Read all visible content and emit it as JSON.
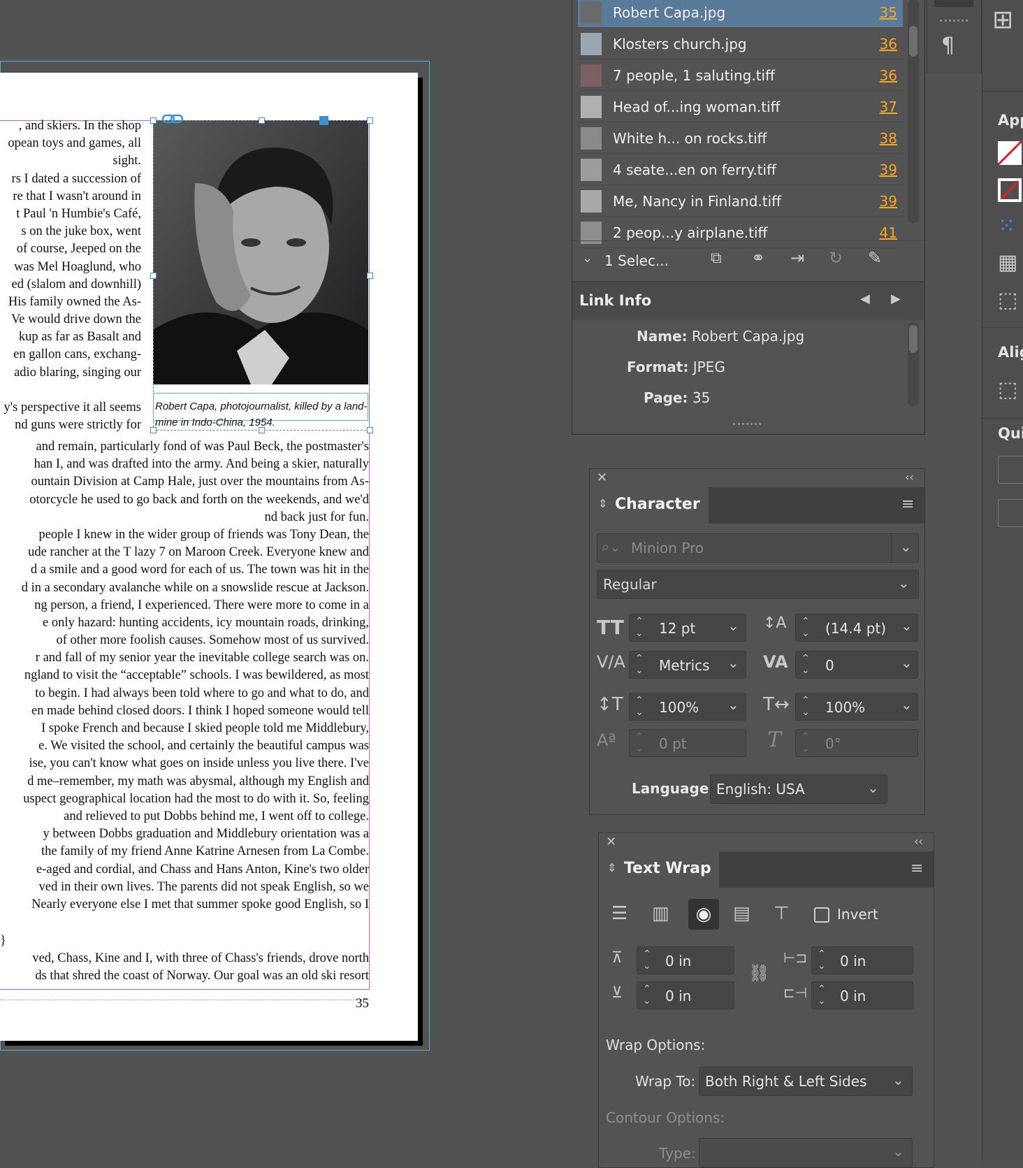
{
  "document": {
    "upper_column_lines": [
      ", and skiers. In the shop",
      "opean toys and games, all",
      " sight.",
      "rs I dated a succession of",
      "re that I wasn't around in",
      "t Paul 'n Humbie's Café,",
      "s on the juke box, went",
      " of course, Jeeped on the",
      " was Mel Hoaglund, who",
      "ed (slalom and downhill)",
      "His family owned the As-",
      "Ve would drive down the",
      "kup as far as Basalt and",
      "en gallon cans, exchang-",
      "adio blaring, singing our",
      "",
      "y's perspective it all seems",
      "nd guns were strictly for"
    ],
    "full_column_lines": [
      "and remain, particularly fond of was Paul Beck, the postmaster's",
      "han I, and was drafted into the army. And being a skier, naturally",
      "ountain Division at Camp Hale, just over the mountains from As-",
      "otorcycle he used to go back and forth on the weekends, and we'd",
      "nd back just for fun.",
      " people I knew in the wider group of friends was Tony Dean, the",
      "ude rancher at the T lazy 7 on Maroon Creek. Everyone knew and",
      "d a smile and a good word for each of us. The town was hit in the",
      "d in a secondary avalanche while on a snowslide rescue at Jackson.",
      "ng person, a friend, I experienced. There were more to come in a",
      "e only hazard: hunting accidents, icy mountain roads, drinking,",
      " of other more foolish causes. Somehow most of us survived.",
      "r and fall of my senior year the inevitable college search was on.",
      "ngland to visit the “acceptable” schools. I was bewildered, as most",
      "to begin. I had always been told where to go and what to do, and",
      "en made behind closed doors. I think I hoped someone would tell",
      " I spoke French and because I skied people told me Middlebury,",
      "e. We visited the school, and certainly the beautiful campus was",
      "ise, you can't know what goes on inside unless you live there. I've",
      "d me–remember, my math was abysmal, although my English and",
      "uspect geographical location had the most to do with it. So, feeling",
      " and relieved to put Dobbs behind me, I went off to college.",
      "y between Dobbs graduation and Middlebury orientation was a",
      "the family of my friend Anne Katrine Arnesen from La Combe.",
      "e-aged and cordial, and Chass and Hans Anton, Kine's two older",
      "ved in their own lives. The parents did not speak English, so we",
      "Nearly everyone else I met that summer spoke good English, so I"
    ],
    "tail_lines": [
      "}",
      "ved, Chass, Kine and I, with three of Chass's friends, drove north",
      "ds that shred the coast of Norway. Our goal was an old ski resort"
    ],
    "caption": "Robert Capa, photojournalist, killed by a land-mine in Indo-China, 1954.",
    "page_number": "35"
  },
  "links_panel": {
    "rows": [
      {
        "name": "Robert Capa.jpg",
        "page": "35",
        "selected": true
      },
      {
        "name": "Klosters church.jpg",
        "page": "36"
      },
      {
        "name": "7 people, 1 saluting.tiff",
        "page": "36"
      },
      {
        "name": "Head of...ing woman.tiff",
        "page": "37"
      },
      {
        "name": "White h... on rocks.tiff",
        "page": "38"
      },
      {
        "name": "4 seate...en on ferry.tiff",
        "page": "39"
      },
      {
        "name": "Me, Nancy in Finland.tiff",
        "page": "39"
      },
      {
        "name": "2  peop...y airplane.tiff",
        "page": "41"
      }
    ],
    "selection_label": "1 Selec...",
    "link_info_title": "Link Info",
    "info": {
      "name_label": "Name:",
      "name_value": "Robert Capa.jpg",
      "format_label": "Format:",
      "format_value": "JPEG",
      "page_label": "Page:",
      "page_value": "35"
    }
  },
  "character_panel": {
    "title": "Character",
    "font_family_placeholder": "Minion Pro",
    "font_style": "Regular",
    "font_size": "12 pt",
    "leading": "(14.4 pt)",
    "kerning": "Metrics",
    "tracking": "0",
    "vertical_scale": "100%",
    "horizontal_scale": "100%",
    "baseline_shift": "0 pt",
    "skew": "0°",
    "language_label": "Language:",
    "language": "English: USA"
  },
  "text_wrap_panel": {
    "title": "Text Wrap",
    "invert_label": "Invert",
    "top_offset": "0 in",
    "bottom_offset": "0 in",
    "left_offset": "0 in",
    "right_offset": "0 in",
    "wrap_options_label": "Wrap Options:",
    "wrap_to_label": "Wrap To:",
    "wrap_to_value": "Both Right & Left Sides",
    "contour_options_label": "Contour Options:",
    "type_label": "Type:"
  },
  "right_strip": {
    "appearance_label": "App",
    "align_label": "Alig",
    "quick_label": "Qui"
  },
  "colors": {
    "selection_blue": "#5a7a9a",
    "page_link_orange": "#f5a623",
    "frame_blue": "#3d8fd6",
    "text_frame_purple": "#c261d6"
  }
}
